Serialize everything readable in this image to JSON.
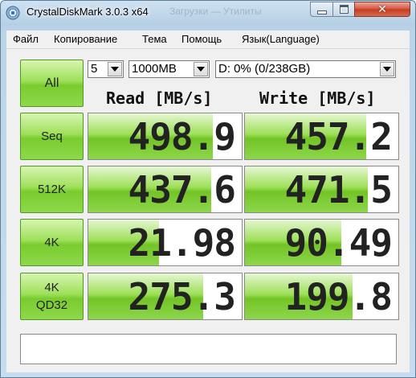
{
  "window": {
    "title": "CrystalDiskMark 3.0.3 x64",
    "ghost_title": "Загрузки — Утилиты"
  },
  "menu": [
    "Файл",
    "Копирование",
    "Тема",
    "Помощь",
    "Язык(Language)"
  ],
  "controls": {
    "all_label": "All",
    "count": "5",
    "size": "1000MB",
    "drive": "D: 0% (0/238GB)"
  },
  "columns": {
    "read": "Read [MB/s]",
    "write": "Write [MB/s]"
  },
  "rows": [
    {
      "label": "Seq",
      "read": "498.9",
      "write": "457.2",
      "read_fill": 0.81,
      "write_fill": 0.79
    },
    {
      "label": "512K",
      "read": "437.6",
      "write": "471.5",
      "read_fill": 0.8,
      "write_fill": 0.8
    },
    {
      "label": "4K",
      "read": "21.98",
      "write": "90.49",
      "read_fill": 0.46,
      "write_fill": 0.63
    },
    {
      "label": "4K QD32",
      "read": "275.3",
      "write": "199.8",
      "read_fill": 0.75,
      "write_fill": 0.7
    }
  ],
  "status_text": "",
  "colors": {
    "accent_green": "#79cc2e",
    "button_border": "#4f9a1f",
    "close_red": "#c53a21"
  },
  "icons": {
    "app": "disk-icon",
    "minimize": "minimize-icon",
    "maximize": "maximize-icon",
    "close": "close-icon",
    "dropdown": "chevron-down-icon"
  }
}
